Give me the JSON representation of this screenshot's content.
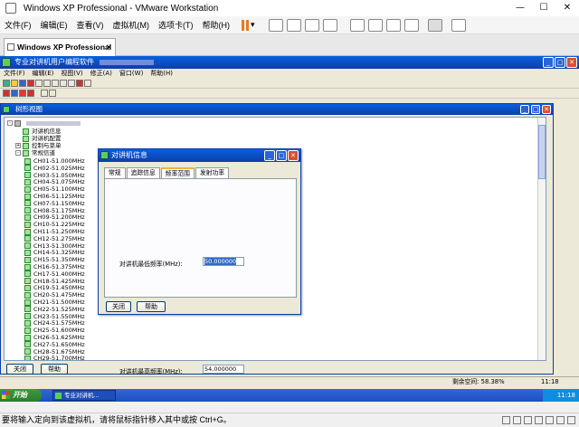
{
  "host": {
    "title": "Windows XP Professional - VMware Workstation",
    "menu": [
      "文件(F)",
      "编辑(E)",
      "查看(V)",
      "虚拟机(M)",
      "选项卡(T)",
      "帮助(H)"
    ],
    "tab_label": "Windows XP Professional",
    "status_text": "要将输入定向到该虚拟机，请将鼠标指针移入其中或按 Ctrl+G。"
  },
  "app": {
    "title": "专业对讲机用户编程软件",
    "menu": [
      "文件(F)",
      "编辑(E)",
      "视图(V)",
      "修正(A)",
      "窗口(W)",
      "帮助(H)"
    ]
  },
  "tree": {
    "title": "树形视图",
    "top_items": [
      {
        "label": "对讲机信息",
        "expander": ""
      },
      {
        "label": "对讲机配置",
        "expander": ""
      },
      {
        "label": "控制与菜单",
        "expander": "+"
      },
      {
        "label": "常规信道",
        "expander": "-"
      }
    ],
    "channels": [
      "CH01-51.000MHz",
      "CH02-51.025MHz",
      "CH03-51.050MHz",
      "CH04-51.075MHz",
      "CH05-51.100MHz",
      "CH06-51.125MHz",
      "CH07-51.150MHz",
      "CH08-51.175MHz",
      "CH09-51.200MHz",
      "CH10-51.225MHz",
      "CH11-51.250MHz",
      "CH12-51.275MHz",
      "CH13-51.300MHz",
      "CH14-51.325MHz",
      "CH15-51.350MHz",
      "CH16-51.375MHz",
      "CH17-51.400MHz",
      "CH18-51.425MHz",
      "CH19-51.450MHz",
      "CH20-51.475MHz",
      "CH21-51.500MHz",
      "CH22-51.525MHz",
      "CH23-51.550MHz",
      "CH24-51.575MHz",
      "CH25-51.600MHz",
      "CH26-51.625MHz",
      "CH27-51.650MHz",
      "CH28-51.675MHz",
      "CH29-51.700MHz"
    ],
    "close_label": "关闭",
    "help_label": "帮助"
  },
  "dialog": {
    "title": "对讲机信息",
    "tabs": [
      "常规",
      "追踪信息",
      "频率范围",
      "发射功率"
    ],
    "active_tab": 2,
    "min_freq_label": "对讲机最低频率(MHz):",
    "min_freq_value": "50.000000",
    "max_freq_label": "对讲机最高频率(MHz):",
    "max_freq_value": "54.000000",
    "close_label": "关闭",
    "help_label": "帮助"
  },
  "status": {
    "free_space": "剩余空间: 58.38%",
    "time": "11:18"
  },
  "taskbar": {
    "start_label": "开始",
    "task_label": "专业对讲机...",
    "clock": "11:18"
  },
  "colors": {
    "xp_title": "#0b3fa8",
    "taskbar": "#1d4fc1",
    "start": "#2d7a2d",
    "selection": "#316ac5"
  }
}
